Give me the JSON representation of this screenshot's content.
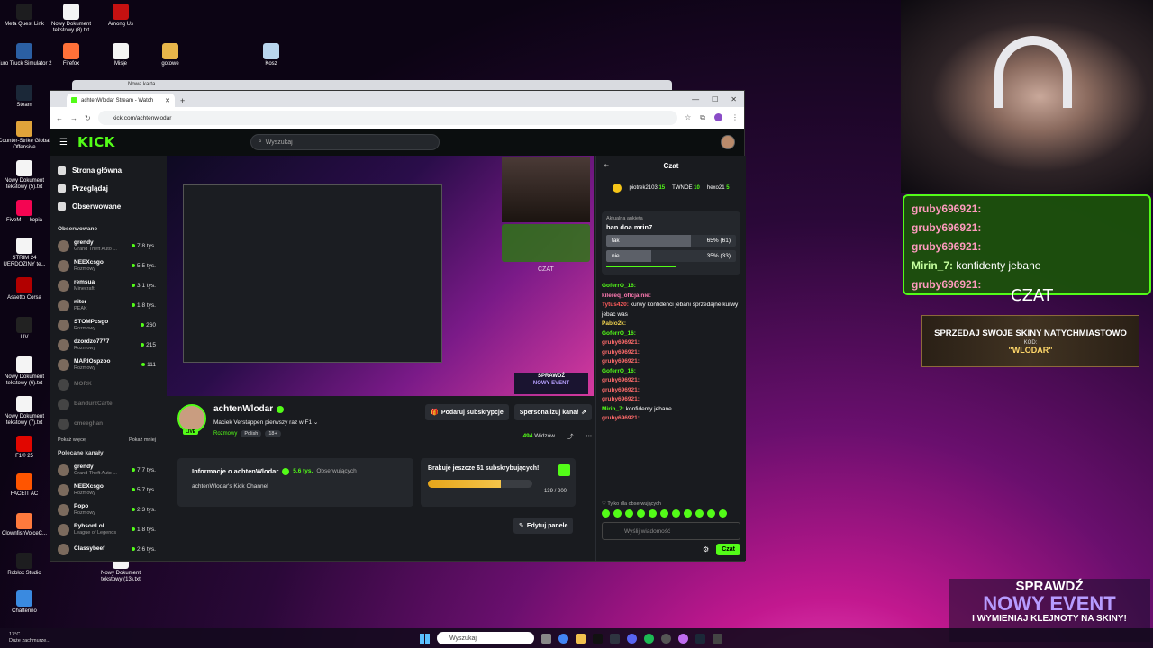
{
  "desktop": {
    "icons": [
      {
        "label": "Meta Quest Link",
        "color": "#1d1d1f"
      },
      {
        "label": "Nowy Dokument tekstowy (8).txt",
        "color": "#f4f4f4"
      },
      {
        "label": "Among Us",
        "color": "#c51111"
      },
      {
        "label": "Euro Truck Simulator 2",
        "color": "#2b5fa3"
      },
      {
        "label": "Firefox",
        "color": "#ff7139"
      },
      {
        "label": "Misje",
        "color": "#f4f4f4"
      },
      {
        "label": "gotowe",
        "color": "#e8b64a"
      },
      {
        "label": "Kosz",
        "color": "#b9d6ee"
      },
      {
        "label": "Steam",
        "color": "#1b2838"
      },
      {
        "label": "Counter-Strike Global Offensive",
        "color": "#e0a33a"
      },
      {
        "label": "Nowy Dokument tekstowy (5).txt",
        "color": "#f4f4f4"
      },
      {
        "label": "FiveM — kopia",
        "color": "#f40552"
      },
      {
        "label": "STRIM 24 UERDOZINY te...",
        "color": "#f4f4f4"
      },
      {
        "label": "Assetto Corsa",
        "color": "#b20000"
      },
      {
        "label": "LIV",
        "color": "#222"
      },
      {
        "label": "Nowy Dokument tekstowy (6).txt",
        "color": "#f4f4f4"
      },
      {
        "label": "Nowy Dokument tekstowy (7).txt",
        "color": "#f4f4f4"
      },
      {
        "label": "F1® 25",
        "color": "#e10600"
      },
      {
        "label": "FACEIT AC",
        "color": "#ff5500"
      },
      {
        "label": "ClownfishVoiceC...",
        "color": "#ff7a3d"
      },
      {
        "label": "Nowy Dokument tekstowy (13).txt",
        "color": "#f4f4f4"
      },
      {
        "label": "Roblox Studio",
        "color": "#1d1d1f"
      },
      {
        "label": "Chatterino",
        "color": "#3a8ae0"
      }
    ]
  },
  "browser": {
    "bg_tab": "Nowa karta",
    "tab_title": "achtenWlodar Stream - Watch",
    "url": "kick.com/achtenwlodar"
  },
  "kick": {
    "logo": "KICK",
    "search_placeholder": "Wyszukaj",
    "nav": [
      "Strona główna",
      "Przeglądaj",
      "Obserwowane"
    ],
    "followed_header": "Obserwowane",
    "followed": [
      {
        "name": "grendy",
        "game": "Grand Theft Auto ...",
        "viewers": "7,8 tys."
      },
      {
        "name": "NEEXcsgo",
        "game": "Rozmowy",
        "viewers": "5,5 tys."
      },
      {
        "name": "remsua",
        "game": "Minecraft",
        "viewers": "3,1 tys."
      },
      {
        "name": "niter",
        "game": "PEAK",
        "viewers": "1,8 tys."
      },
      {
        "name": "STOMPcsgo",
        "game": "Rozmowy",
        "viewers": "260"
      },
      {
        "name": "dzordzo7777",
        "game": "Rozmowy",
        "viewers": "215"
      },
      {
        "name": "MARIOspzoo",
        "game": "Rozmowy",
        "viewers": "111"
      }
    ],
    "offline": [
      "MORK",
      "BandurzCartel",
      "cmeeghan"
    ],
    "show_more": "Pokaż więcej",
    "show_less": "Pokaż mniej",
    "recommended_header": "Polecane kanały",
    "recommended": [
      {
        "name": "grendy",
        "game": "Grand Theft Auto ...",
        "viewers": "7,7 tys."
      },
      {
        "name": "NEEXcsgo",
        "game": "Rozmowy",
        "viewers": "5,7 tys."
      },
      {
        "name": "Popo",
        "game": "Rozmowy",
        "viewers": "2,3 tys."
      },
      {
        "name": "RybsonLoL",
        "game": "League of Legends",
        "viewers": "1,8 tys."
      },
      {
        "name": "Classybeef",
        "game": "",
        "viewers": "2,6 tys."
      }
    ],
    "stream_overlay": {
      "event_line1": "SPRAWDŹ",
      "event_line2": "NOWY EVENT",
      "czat": "CZAT"
    },
    "streamer": {
      "name": "achtenWlodar",
      "live": "LIVE",
      "title": "Maciek Verstappen pierwszy raz w F1",
      "category": "Rozmowy",
      "tags": [
        "Polish",
        "18+"
      ],
      "gift_btn": "Podaruj subskrypcje",
      "personalize_btn": "Spersonalizuj kanał",
      "viewers": "494",
      "viewers_label": "Widzów"
    },
    "about": {
      "title": "Informacje o achtenWlodar",
      "followers": "5,6 tys.",
      "followers_label": "Obserwujących",
      "description": "achtenWlodar's Kick Channel"
    },
    "goal": {
      "text": "Brakuje jeszcze 61 subskrybujących!",
      "count": "139 / 200",
      "progress": 0.695
    },
    "edit_panels": "Edytuj panele"
  },
  "chat": {
    "title": "Czat",
    "top": [
      {
        "name": "piotrek2103",
        "count": "15"
      },
      {
        "name": "TWNOE",
        "count": "10"
      },
      {
        "name": "hexo21",
        "count": "5"
      }
    ],
    "poll": {
      "header": "Aktualna ankieta",
      "question": "ban doa mrin7",
      "options": [
        {
          "label": "tak",
          "result": "65% (61)",
          "share": 0.65
        },
        {
          "label": "nie",
          "result": "35% (33)",
          "share": 0.35
        }
      ]
    },
    "messages": [
      {
        "user": "GoferrO_16:",
        "text": "",
        "cls": "ug"
      },
      {
        "user": "kilereq_oficjalnie:",
        "text": "",
        "cls": "up"
      },
      {
        "user": "Tytus420:",
        "text": "kurwy konfidenci jebani sprzedajne kurwy jebac was",
        "cls": "ur"
      },
      {
        "user": "Pablo2k:",
        "text": "",
        "cls": "uy"
      },
      {
        "user": "GoferrO_16:",
        "text": "",
        "cls": "ug"
      },
      {
        "user": "gruby696921:",
        "text": "",
        "cls": "uo"
      },
      {
        "user": "gruby696921:",
        "text": "",
        "cls": "uo"
      },
      {
        "user": "gruby696921:",
        "text": "",
        "cls": "uo"
      },
      {
        "user": "GoferrO_16:",
        "text": "",
        "cls": "ug"
      },
      {
        "user": "gruby696921:",
        "text": "",
        "cls": "uo"
      },
      {
        "user": "gruby696921:",
        "text": "",
        "cls": "uo"
      },
      {
        "user": "gruby696921:",
        "text": "",
        "cls": "uo"
      },
      {
        "user": "Mirin_7:",
        "text": "konfidenty jebane",
        "cls": "ug"
      },
      {
        "user": "gruby696921:",
        "text": "",
        "cls": "uo"
      }
    ],
    "followers_only": "Tylko dla obserwujących",
    "input_placeholder": "Wyślij wiadomość",
    "send": "Czat"
  },
  "overlay": {
    "chat_lines": [
      {
        "user": "gruby696921:",
        "text": ""
      },
      {
        "user": "gruby696921:",
        "text": ""
      },
      {
        "user": "gruby696921:",
        "text": ""
      },
      {
        "user": "Mirin_7:",
        "text": "konfidenty jebane"
      },
      {
        "user": "gruby696921:",
        "text": ""
      }
    ],
    "czat": "CZAT",
    "skins_title": "SPRZEDAJ SWOJE SKINY NATYCHMIASTOWO",
    "skins_code_label": "KOD:",
    "skins_code": "\"WLODAR\"",
    "event_a": "SPRAWDŹ",
    "event_b": "NOWY EVENT",
    "event_c": "I WYMIENIAJ KLEJNOTY NA SKINY!"
  },
  "taskbar": {
    "temp": "17°C",
    "weather": "Duże zachmurze...",
    "search": "Wyszukaj"
  },
  "colors": {
    "accent": "#53fc18"
  }
}
